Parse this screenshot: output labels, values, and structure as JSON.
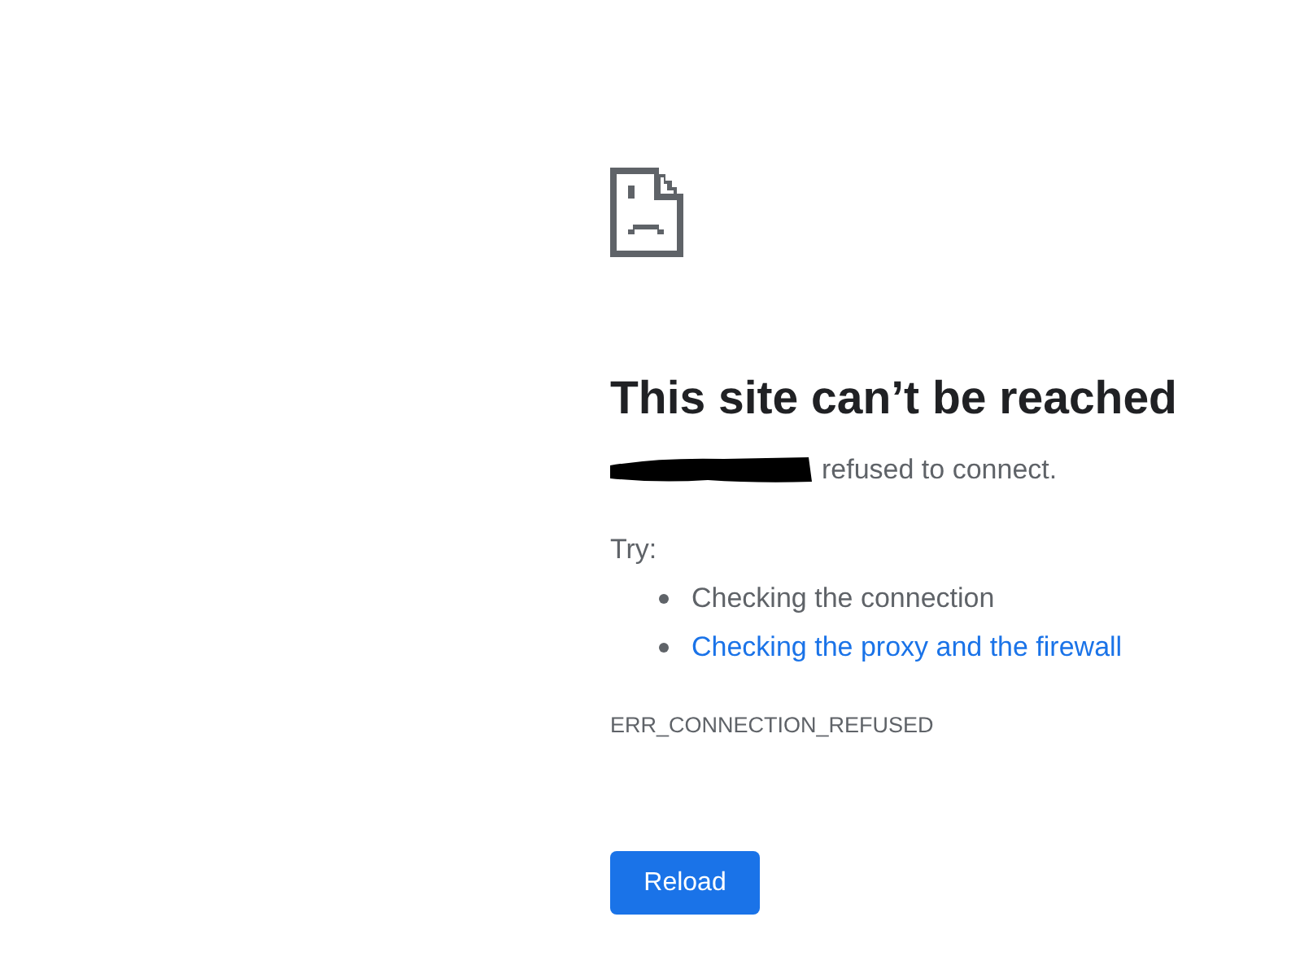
{
  "heading": "This site can’t be reached",
  "message": {
    "host_redacted": true,
    "text": "refused to connect."
  },
  "try_label": "Try:",
  "suggestions": [
    {
      "kind": "text",
      "text": "Checking the connection"
    },
    {
      "kind": "link",
      "text": "Checking the proxy and the firewall"
    }
  ],
  "error_code": "ERR_CONNECTION_REFUSED",
  "buttons": [
    {
      "label": "Reload"
    }
  ]
}
